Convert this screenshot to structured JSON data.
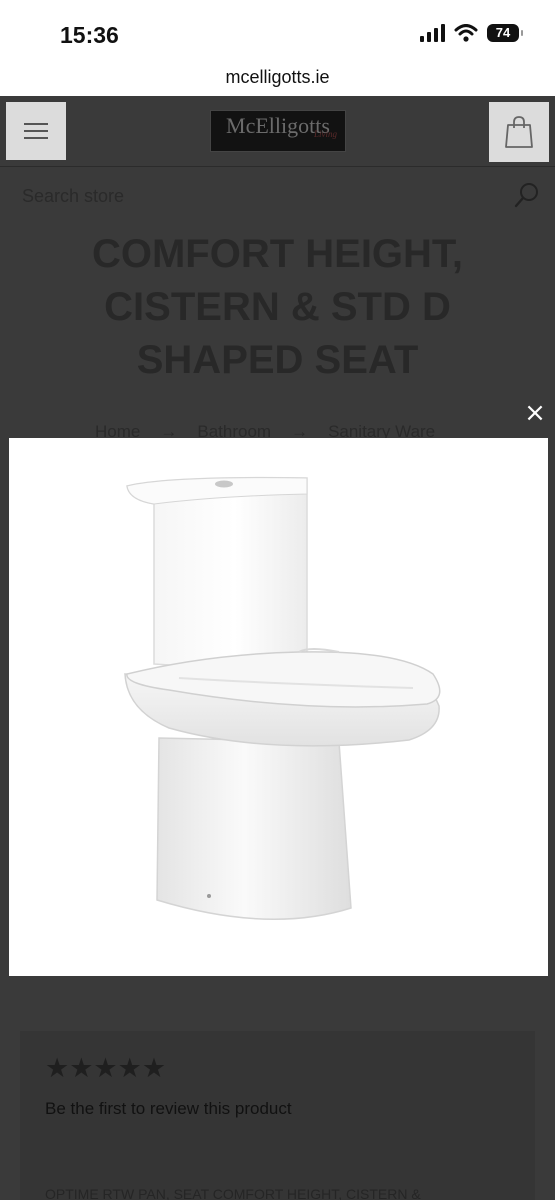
{
  "status": {
    "time": "15:36",
    "battery": "74"
  },
  "browser": {
    "url": "mcelligotts.ie"
  },
  "header": {
    "logo_text": "McElligotts",
    "logo_sub": "Living"
  },
  "search": {
    "placeholder": "Search store"
  },
  "product": {
    "title": "COMFORT HEIGHT, CISTERN & STD D SHAPED SEAT"
  },
  "breadcrumb": [
    {
      "label": "Home"
    },
    {
      "label": "Bathroom"
    },
    {
      "label": "Sanitary Ware"
    }
  ],
  "breadcrumb_separator": "→",
  "modal": {
    "close_label": "×",
    "image_alt": "Close-coupled toilet with cistern and D shaped seat"
  },
  "reviews": {
    "stars": "★★★★★",
    "rating": 0,
    "prompt": "Be the first to review this product"
  },
  "description_snippet": "OPTIME RTW PAN, SEAT COMFORT HEIGHT, CISTERN &",
  "colors": {
    "overlay_background": "#3a3a3a",
    "modal_background": "#ffffff",
    "button_background": "#dcdcdc"
  }
}
